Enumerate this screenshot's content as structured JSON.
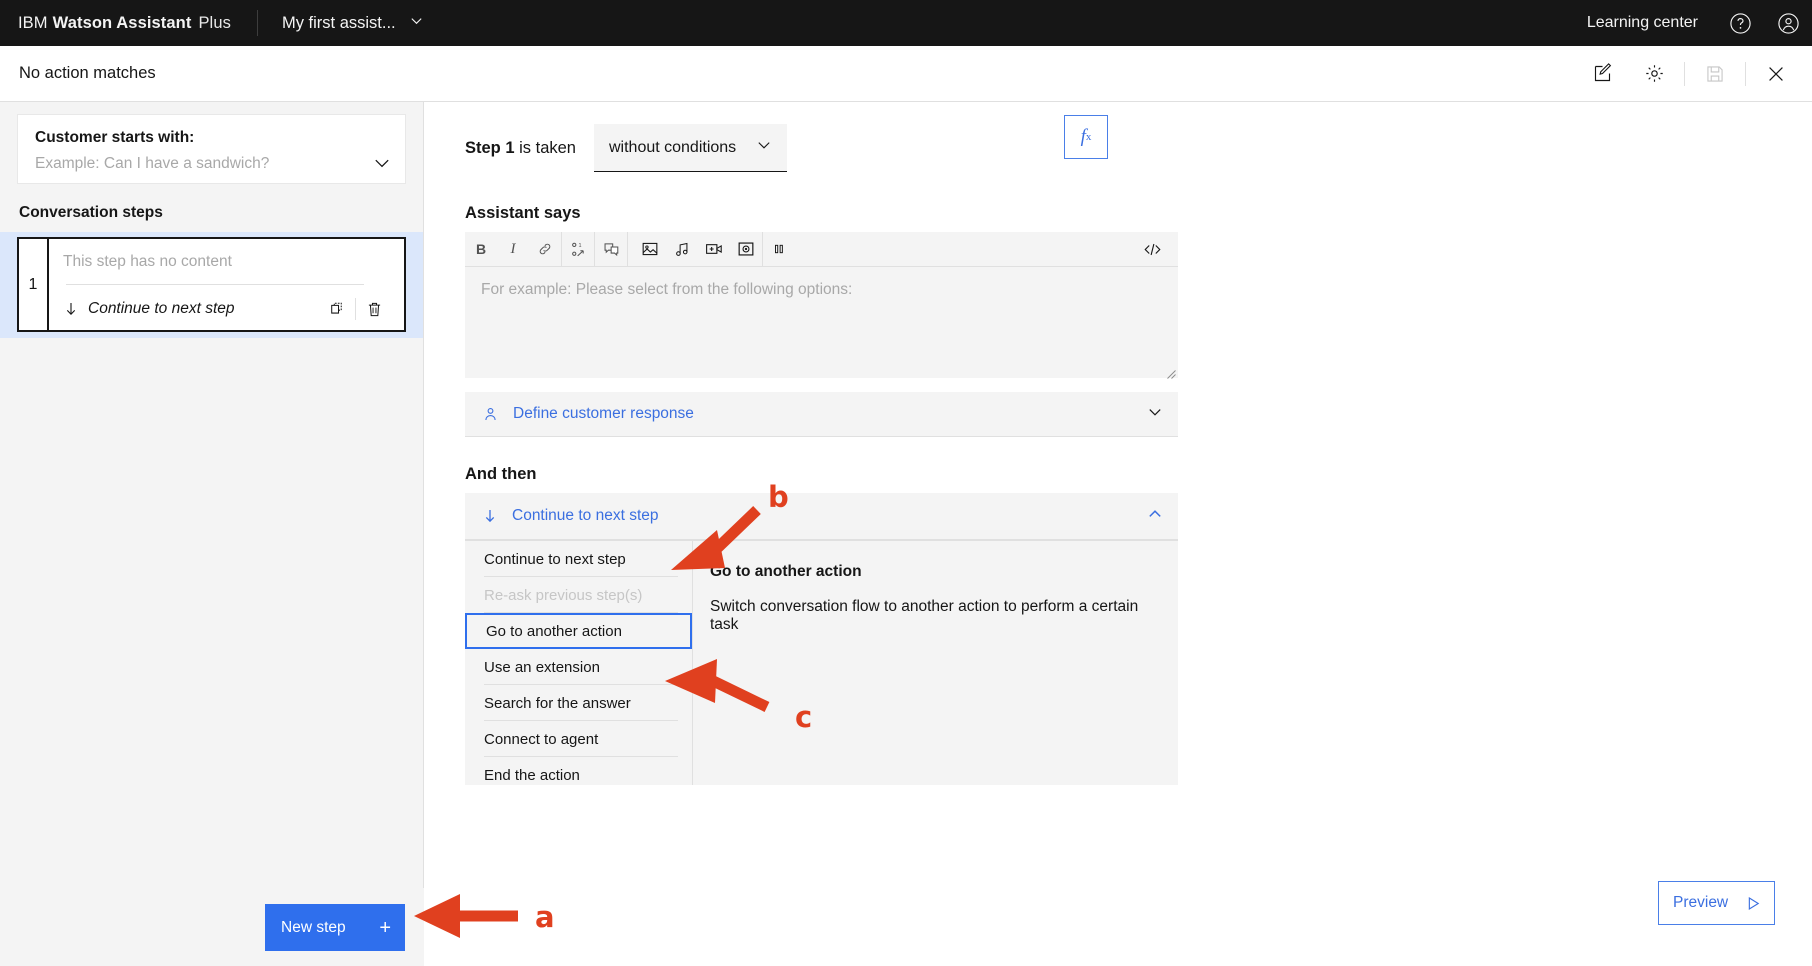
{
  "topbar": {
    "ibm": "IBM",
    "product": "Watson Assistant",
    "plan": "Plus",
    "assistant_name": "My first assist...",
    "learning_center": "Learning center",
    "help_icon": "help-circle-icon",
    "account_icon": "user-avatar-icon",
    "chevron_icon": "chevron-down-icon"
  },
  "subbar": {
    "title": "No action matches",
    "icons": [
      "edit-pencil-icon",
      "settings-gear-icon",
      "save-disk-icon",
      "close-x-icon"
    ]
  },
  "sidebar": {
    "starts_with": {
      "title": "Customer starts with:",
      "example": "Example: Can I have a sandwich?"
    },
    "conversation_steps_label": "Conversation steps",
    "step": {
      "number": "1",
      "no_content": "This step has no content",
      "continue": "Continue to next step",
      "duplicate_icon": "copy-icon",
      "delete_icon": "trash-icon"
    },
    "new_step_label": "New step",
    "new_step_plus": "+"
  },
  "main": {
    "step_prefix": "Step 1",
    "step_suffix": " is taken",
    "condition_value": "without conditions",
    "fx_label": "f",
    "fx_sub": "x",
    "assistant_says_label": "Assistant says",
    "editor": {
      "placeholder": "For example: Please select from the following options:",
      "toolbar": [
        {
          "name": "bold-icon",
          "glyph": "B"
        },
        {
          "name": "italic-icon",
          "glyph": "I"
        },
        {
          "name": "link-icon",
          "glyph": "link"
        },
        {
          "name": "variable-icon",
          "glyph": "variable"
        },
        {
          "name": "conditional-response-icon",
          "glyph": "conditional"
        },
        {
          "name": "image-icon",
          "glyph": "image"
        },
        {
          "name": "audio-icon",
          "glyph": "audio"
        },
        {
          "name": "video-icon",
          "glyph": "video"
        },
        {
          "name": "iframe-icon",
          "glyph": "iframe"
        },
        {
          "name": "pause-icon",
          "glyph": "pause"
        }
      ],
      "code_icon": "code-brackets-icon"
    },
    "define_customer_response": "Define customer response",
    "and_then_label": "And then",
    "continue_to_next_step": "Continue to next step",
    "dropdown": {
      "options": [
        {
          "label": "Continue to next step",
          "state": "normal"
        },
        {
          "label": "Re-ask previous step(s)",
          "state": "disabled"
        },
        {
          "label": "Go to another action",
          "state": "selected"
        },
        {
          "label": "Use an extension",
          "state": "normal"
        },
        {
          "label": "Search for the answer",
          "state": "normal"
        },
        {
          "label": "Connect to agent",
          "state": "normal"
        },
        {
          "label": "End the action",
          "state": "normal"
        }
      ],
      "detail_title": "Go to another action",
      "detail_desc": "Switch conversation flow to another action to perform a certain task"
    },
    "preview_label": "Preview"
  },
  "annotations": {
    "a": "a",
    "b": "b",
    "c": "c",
    "color": "#e0401f"
  }
}
